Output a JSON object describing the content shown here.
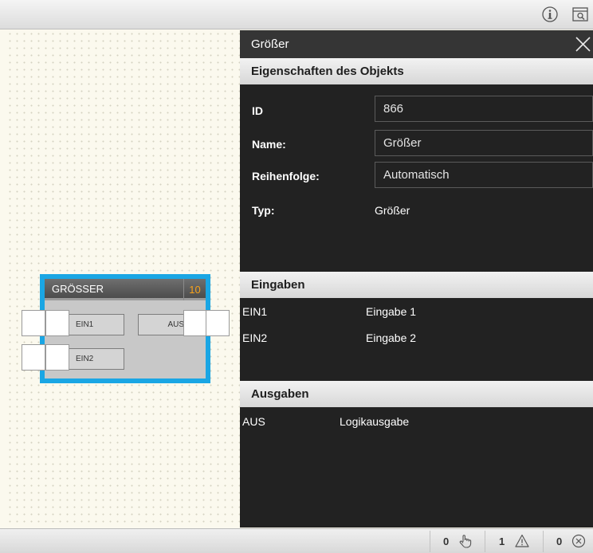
{
  "toolbar": {
    "icons": [
      "info-icon",
      "search-window-icon"
    ]
  },
  "block": {
    "title": "GRÖSSER",
    "order_number": "10",
    "inputs": [
      "EIN1",
      "EIN2"
    ],
    "outputs": [
      "AUS"
    ],
    "frame_color": "#1aa6e4"
  },
  "panel": {
    "title": "Größer",
    "properties_header": "Eigenschaften des Objekts",
    "props": {
      "id_label": "ID",
      "id_value": "866",
      "name_label": "Name:",
      "name_value": "Größer",
      "order_label": "Reihenfolge:",
      "order_value": "Automatisch",
      "type_label": "Typ:",
      "type_value": "Größer"
    },
    "inputs_header": "Eingaben",
    "inputs": [
      {
        "name": "EIN1",
        "description": "Eingabe 1"
      },
      {
        "name": "EIN2",
        "description": "Eingabe 2"
      }
    ],
    "outputs_header": "Ausgaben",
    "outputs": [
      {
        "name": "AUS",
        "description": "Logikausgabe"
      }
    ]
  },
  "status": {
    "hints": "0",
    "warnings": "1",
    "errors": "0",
    "icons": [
      "hand-pointer-icon",
      "warning-icon",
      "error-icon"
    ]
  }
}
